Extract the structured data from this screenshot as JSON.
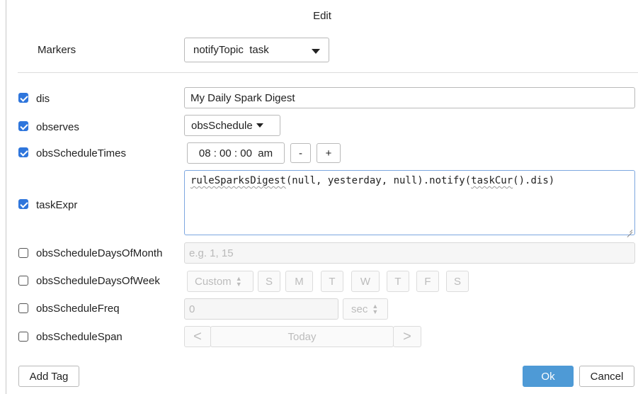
{
  "title": "Edit",
  "markers": {
    "label": "Markers",
    "value": "notifyTopic  task"
  },
  "rows": {
    "dis": {
      "label": "dis",
      "checked": true,
      "value": "My Daily Spark Digest"
    },
    "observes": {
      "label": "observes",
      "checked": true,
      "value": "obsSchedule"
    },
    "obsScheduleTimes": {
      "label": "obsScheduleTimes",
      "checked": true,
      "time": "08 : 00 : 00  am",
      "minus": "-",
      "plus": "+"
    },
    "taskExpr": {
      "label": "taskExpr",
      "checked": true,
      "code_part1": "ruleSparksDigest",
      "code_part2": "(null, yesterday, null).notify(",
      "code_part3": "taskCur",
      "code_part4": "().dis)"
    },
    "obsScheduleDaysOfMonth": {
      "label": "obsScheduleDaysOfMonth",
      "checked": false,
      "placeholder": "e.g. 1, 15"
    },
    "obsScheduleDaysOfWeek": {
      "label": "obsScheduleDaysOfWeek",
      "checked": false,
      "mode": "Custom",
      "days": [
        "S",
        "M",
        "T",
        "W",
        "T",
        "F",
        "S"
      ]
    },
    "obsScheduleFreq": {
      "label": "obsScheduleFreq",
      "checked": false,
      "value": "0",
      "unit": "sec"
    },
    "obsScheduleSpan": {
      "label": "obsScheduleSpan",
      "checked": false,
      "prev": "<",
      "value": "Today",
      "next": ">"
    }
  },
  "footer": {
    "add_tag": "Add Tag",
    "ok": "Ok",
    "cancel": "Cancel"
  },
  "colors": {
    "accent": "#2f76dc",
    "primary_button": "#4e9ad6"
  }
}
